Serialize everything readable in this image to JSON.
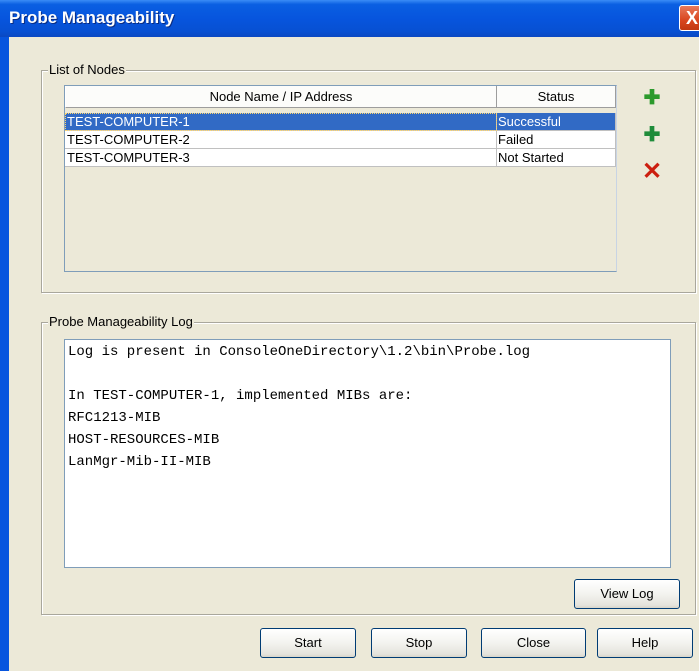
{
  "window": {
    "title": "Probe Manageability",
    "close_glyph": "X"
  },
  "nodes_group": {
    "label": "List of Nodes",
    "columns": [
      "Node Name / IP Address",
      "Status"
    ],
    "rows": [
      {
        "name": "TEST-COMPUTER-1",
        "status": "Successful",
        "selected": true
      },
      {
        "name": "TEST-COMPUTER-2",
        "status": "Failed",
        "selected": false
      },
      {
        "name": "TEST-COMPUTER-3",
        "status": "Not Started",
        "selected": false
      }
    ],
    "side_buttons": [
      {
        "icon": "add-node-icon",
        "glyph": "✚"
      },
      {
        "icon": "add-multiple-icon",
        "glyph": "✚"
      },
      {
        "icon": "delete-icon",
        "glyph": "✕"
      }
    ]
  },
  "log_group": {
    "label": "Probe Manageability Log",
    "lines": [
      "Log is present in ConsoleOneDirectory\\1.2\\bin\\Probe.log",
      "",
      "In TEST-COMPUTER-1, implemented MIBs are:",
      "RFC1213-MIB",
      "HOST-RESOURCES-MIB",
      "LanMgr-Mib-II-MIB"
    ],
    "view_log_label": "View Log"
  },
  "footer": {
    "start_label": "Start",
    "stop_label": "Stop",
    "close_label": "Close",
    "help_label": "Help"
  },
  "colors": {
    "titlebar": "#0755de",
    "selection": "#316ac5",
    "dialog_bg": "#ece9d8"
  }
}
